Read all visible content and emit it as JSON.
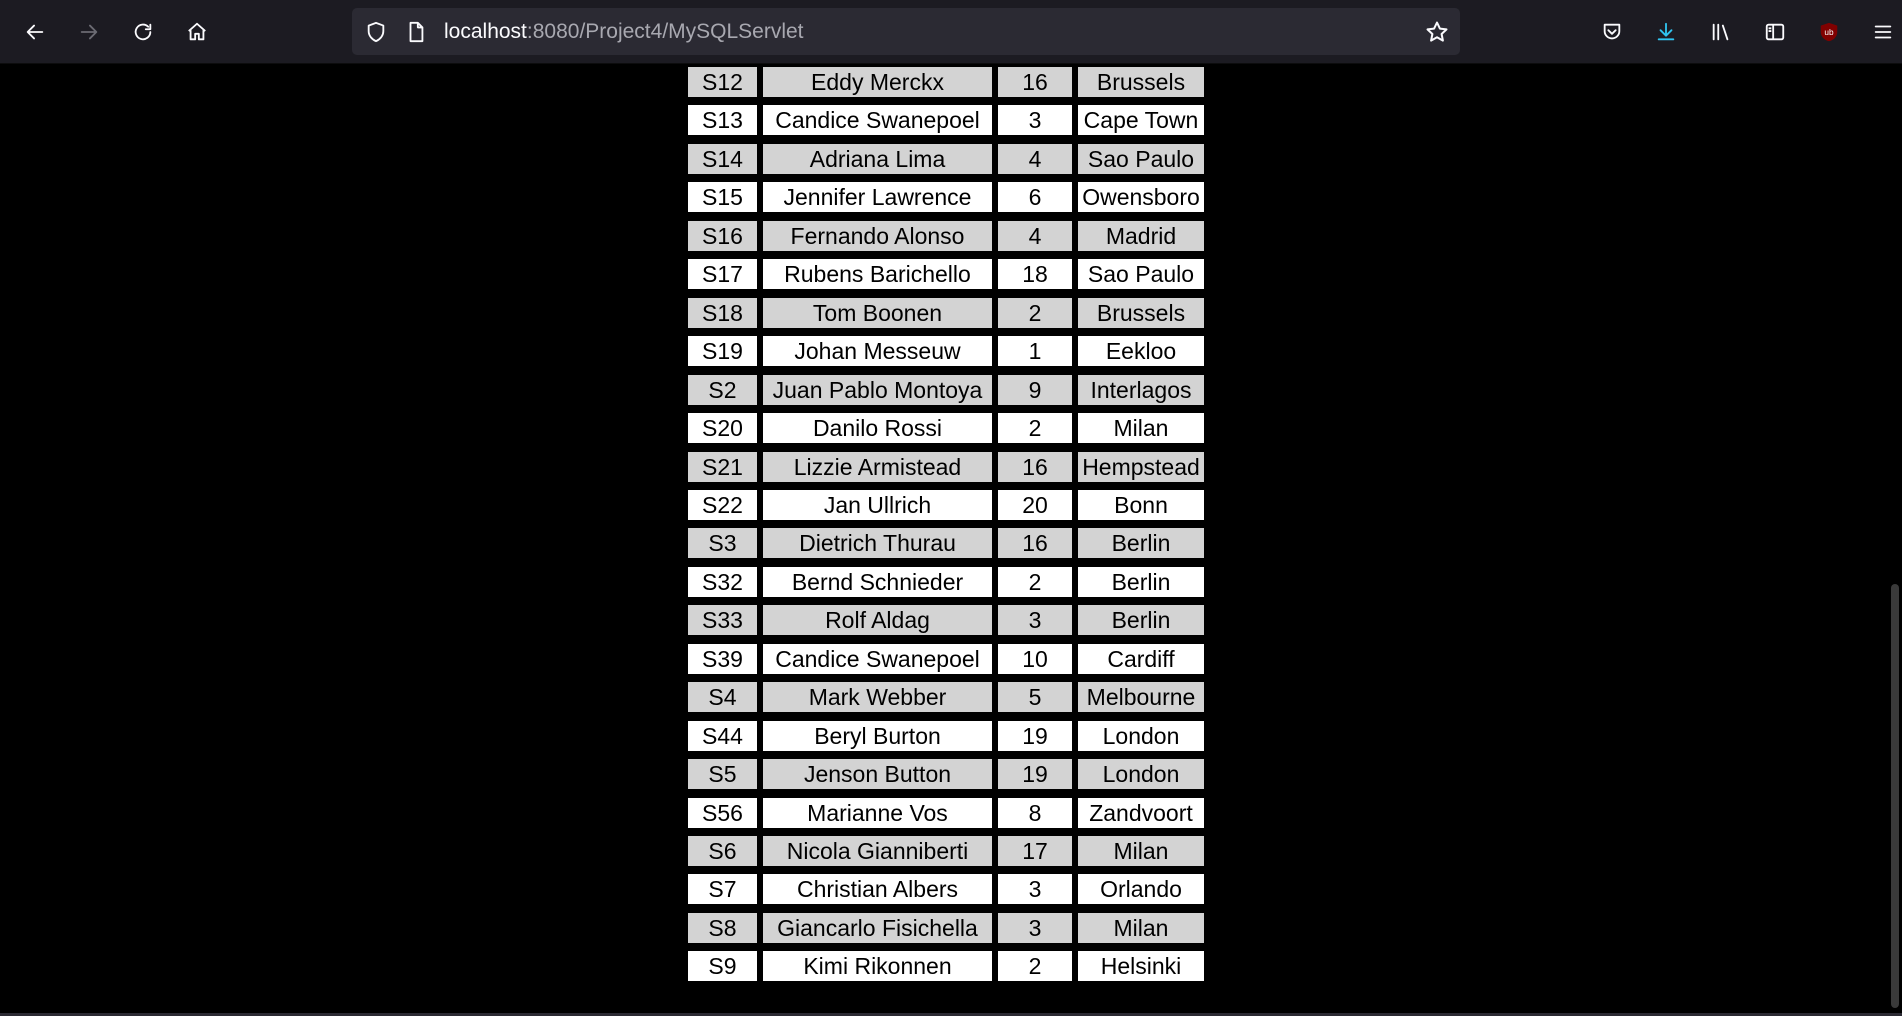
{
  "browser": {
    "url_host": "localhost",
    "url_rest": ":8080/Project4/MySQLServlet",
    "icons": [
      "back-icon",
      "forward-icon",
      "reload-icon",
      "home-icon",
      "shield-icon",
      "page-icon",
      "star-icon",
      "pocket-icon",
      "download-icon",
      "library-icon",
      "sidebar-icon",
      "ublock-icon",
      "menu-icon"
    ]
  },
  "table": {
    "rows": [
      {
        "id": "S12",
        "name": "Eddy Merckx",
        "num": "16",
        "city": "Brussels"
      },
      {
        "id": "S13",
        "name": "Candice Swanepoel",
        "num": "3",
        "city": "Cape Town"
      },
      {
        "id": "S14",
        "name": "Adriana Lima",
        "num": "4",
        "city": "Sao Paulo"
      },
      {
        "id": "S15",
        "name": "Jennifer Lawrence",
        "num": "6",
        "city": "Owensboro"
      },
      {
        "id": "S16",
        "name": "Fernando Alonso",
        "num": "4",
        "city": "Madrid"
      },
      {
        "id": "S17",
        "name": "Rubens Barichello",
        "num": "18",
        "city": "Sao Paulo"
      },
      {
        "id": "S18",
        "name": "Tom Boonen",
        "num": "2",
        "city": "Brussels"
      },
      {
        "id": "S19",
        "name": "Johan Messeuw",
        "num": "1",
        "city": "Eekloo"
      },
      {
        "id": "S2",
        "name": "Juan Pablo Montoya",
        "num": "9",
        "city": "Interlagos"
      },
      {
        "id": "S20",
        "name": "Danilo Rossi",
        "num": "2",
        "city": "Milan"
      },
      {
        "id": "S21",
        "name": "Lizzie Armistead",
        "num": "16",
        "city": "Hempstead"
      },
      {
        "id": "S22",
        "name": "Jan Ullrich",
        "num": "20",
        "city": "Bonn"
      },
      {
        "id": "S3",
        "name": "Dietrich Thurau",
        "num": "16",
        "city": "Berlin"
      },
      {
        "id": "S32",
        "name": "Bernd Schnieder",
        "num": "2",
        "city": "Berlin"
      },
      {
        "id": "S33",
        "name": "Rolf Aldag",
        "num": "3",
        "city": "Berlin"
      },
      {
        "id": "S39",
        "name": "Candice Swanepoel",
        "num": "10",
        "city": "Cardiff"
      },
      {
        "id": "S4",
        "name": "Mark Webber",
        "num": "5",
        "city": "Melbourne"
      },
      {
        "id": "S44",
        "name": "Beryl Burton",
        "num": "19",
        "city": "London"
      },
      {
        "id": "S5",
        "name": "Jenson Button",
        "num": "19",
        "city": "London"
      },
      {
        "id": "S56",
        "name": "Marianne Vos",
        "num": "8",
        "city": "Zandvoort"
      },
      {
        "id": "S6",
        "name": "Nicola Gianniberti",
        "num": "17",
        "city": "Milan"
      },
      {
        "id": "S7",
        "name": "Christian Albers",
        "num": "3",
        "city": "Orlando"
      },
      {
        "id": "S8",
        "name": "Giancarlo Fisichella",
        "num": "3",
        "city": "Milan"
      },
      {
        "id": "S9",
        "name": "Kimi Rikonnen",
        "num": "2",
        "city": "Helsinki"
      }
    ]
  }
}
